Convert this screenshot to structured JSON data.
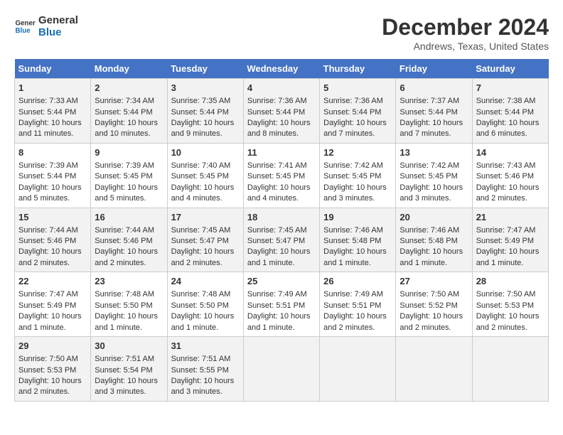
{
  "logo": {
    "line1": "General",
    "line2": "Blue"
  },
  "title": "December 2024",
  "subtitle": "Andrews, Texas, United States",
  "days_of_week": [
    "Sunday",
    "Monday",
    "Tuesday",
    "Wednesday",
    "Thursday",
    "Friday",
    "Saturday"
  ],
  "weeks": [
    [
      {
        "day": "1",
        "sunrise": "Sunrise: 7:33 AM",
        "sunset": "Sunset: 5:44 PM",
        "daylight": "Daylight: 10 hours and 11 minutes."
      },
      {
        "day": "2",
        "sunrise": "Sunrise: 7:34 AM",
        "sunset": "Sunset: 5:44 PM",
        "daylight": "Daylight: 10 hours and 10 minutes."
      },
      {
        "day": "3",
        "sunrise": "Sunrise: 7:35 AM",
        "sunset": "Sunset: 5:44 PM",
        "daylight": "Daylight: 10 hours and 9 minutes."
      },
      {
        "day": "4",
        "sunrise": "Sunrise: 7:36 AM",
        "sunset": "Sunset: 5:44 PM",
        "daylight": "Daylight: 10 hours and 8 minutes."
      },
      {
        "day": "5",
        "sunrise": "Sunrise: 7:36 AM",
        "sunset": "Sunset: 5:44 PM",
        "daylight": "Daylight: 10 hours and 7 minutes."
      },
      {
        "day": "6",
        "sunrise": "Sunrise: 7:37 AM",
        "sunset": "Sunset: 5:44 PM",
        "daylight": "Daylight: 10 hours and 7 minutes."
      },
      {
        "day": "7",
        "sunrise": "Sunrise: 7:38 AM",
        "sunset": "Sunset: 5:44 PM",
        "daylight": "Daylight: 10 hours and 6 minutes."
      }
    ],
    [
      {
        "day": "8",
        "sunrise": "Sunrise: 7:39 AM",
        "sunset": "Sunset: 5:44 PM",
        "daylight": "Daylight: 10 hours and 5 minutes."
      },
      {
        "day": "9",
        "sunrise": "Sunrise: 7:39 AM",
        "sunset": "Sunset: 5:45 PM",
        "daylight": "Daylight: 10 hours and 5 minutes."
      },
      {
        "day": "10",
        "sunrise": "Sunrise: 7:40 AM",
        "sunset": "Sunset: 5:45 PM",
        "daylight": "Daylight: 10 hours and 4 minutes."
      },
      {
        "day": "11",
        "sunrise": "Sunrise: 7:41 AM",
        "sunset": "Sunset: 5:45 PM",
        "daylight": "Daylight: 10 hours and 4 minutes."
      },
      {
        "day": "12",
        "sunrise": "Sunrise: 7:42 AM",
        "sunset": "Sunset: 5:45 PM",
        "daylight": "Daylight: 10 hours and 3 minutes."
      },
      {
        "day": "13",
        "sunrise": "Sunrise: 7:42 AM",
        "sunset": "Sunset: 5:45 PM",
        "daylight": "Daylight: 10 hours and 3 minutes."
      },
      {
        "day": "14",
        "sunrise": "Sunrise: 7:43 AM",
        "sunset": "Sunset: 5:46 PM",
        "daylight": "Daylight: 10 hours and 2 minutes."
      }
    ],
    [
      {
        "day": "15",
        "sunrise": "Sunrise: 7:44 AM",
        "sunset": "Sunset: 5:46 PM",
        "daylight": "Daylight: 10 hours and 2 minutes."
      },
      {
        "day": "16",
        "sunrise": "Sunrise: 7:44 AM",
        "sunset": "Sunset: 5:46 PM",
        "daylight": "Daylight: 10 hours and 2 minutes."
      },
      {
        "day": "17",
        "sunrise": "Sunrise: 7:45 AM",
        "sunset": "Sunset: 5:47 PM",
        "daylight": "Daylight: 10 hours and 2 minutes."
      },
      {
        "day": "18",
        "sunrise": "Sunrise: 7:45 AM",
        "sunset": "Sunset: 5:47 PM",
        "daylight": "Daylight: 10 hours and 1 minute."
      },
      {
        "day": "19",
        "sunrise": "Sunrise: 7:46 AM",
        "sunset": "Sunset: 5:48 PM",
        "daylight": "Daylight: 10 hours and 1 minute."
      },
      {
        "day": "20",
        "sunrise": "Sunrise: 7:46 AM",
        "sunset": "Sunset: 5:48 PM",
        "daylight": "Daylight: 10 hours and 1 minute."
      },
      {
        "day": "21",
        "sunrise": "Sunrise: 7:47 AM",
        "sunset": "Sunset: 5:49 PM",
        "daylight": "Daylight: 10 hours and 1 minute."
      }
    ],
    [
      {
        "day": "22",
        "sunrise": "Sunrise: 7:47 AM",
        "sunset": "Sunset: 5:49 PM",
        "daylight": "Daylight: 10 hours and 1 minute."
      },
      {
        "day": "23",
        "sunrise": "Sunrise: 7:48 AM",
        "sunset": "Sunset: 5:50 PM",
        "daylight": "Daylight: 10 hours and 1 minute."
      },
      {
        "day": "24",
        "sunrise": "Sunrise: 7:48 AM",
        "sunset": "Sunset: 5:50 PM",
        "daylight": "Daylight: 10 hours and 1 minute."
      },
      {
        "day": "25",
        "sunrise": "Sunrise: 7:49 AM",
        "sunset": "Sunset: 5:51 PM",
        "daylight": "Daylight: 10 hours and 1 minute."
      },
      {
        "day": "26",
        "sunrise": "Sunrise: 7:49 AM",
        "sunset": "Sunset: 5:51 PM",
        "daylight": "Daylight: 10 hours and 2 minutes."
      },
      {
        "day": "27",
        "sunrise": "Sunrise: 7:50 AM",
        "sunset": "Sunset: 5:52 PM",
        "daylight": "Daylight: 10 hours and 2 minutes."
      },
      {
        "day": "28",
        "sunrise": "Sunrise: 7:50 AM",
        "sunset": "Sunset: 5:53 PM",
        "daylight": "Daylight: 10 hours and 2 minutes."
      }
    ],
    [
      {
        "day": "29",
        "sunrise": "Sunrise: 7:50 AM",
        "sunset": "Sunset: 5:53 PM",
        "daylight": "Daylight: 10 hours and 2 minutes."
      },
      {
        "day": "30",
        "sunrise": "Sunrise: 7:51 AM",
        "sunset": "Sunset: 5:54 PM",
        "daylight": "Daylight: 10 hours and 3 minutes."
      },
      {
        "day": "31",
        "sunrise": "Sunrise: 7:51 AM",
        "sunset": "Sunset: 5:55 PM",
        "daylight": "Daylight: 10 hours and 3 minutes."
      },
      null,
      null,
      null,
      null
    ]
  ]
}
